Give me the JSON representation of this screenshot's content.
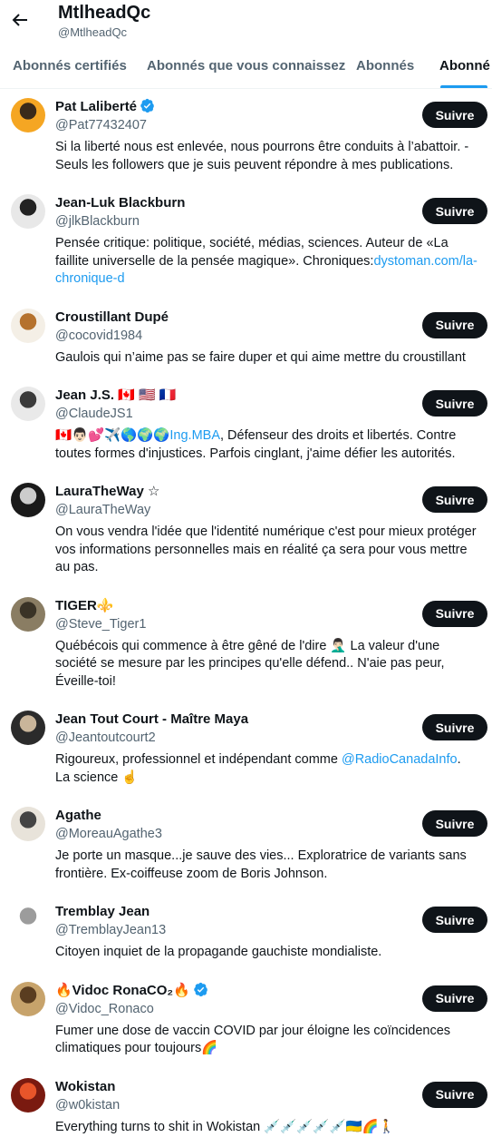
{
  "header": {
    "title": "MtlheadQc",
    "handle": "@MtlheadQc"
  },
  "tabs": [
    {
      "label": "Abonnés certifiés"
    },
    {
      "label": "Abonnés que vous connaissez"
    },
    {
      "label": "Abonnés"
    },
    {
      "label": "Abonné"
    }
  ],
  "follow_label": "Suivre",
  "accounts": [
    {
      "name": "Pat Laliberté",
      "verified": true,
      "handle": "@Pat77432407",
      "bio": "Si la liberté nous est enlevée, nous pourrons être conduits à l’abattoir. - Seuls les followers que je suis peuvent répondre à mes publications.",
      "avatar_colors": [
        "#f5a623",
        "#3a2a1a"
      ]
    },
    {
      "name": "Jean-Luk Blackburn",
      "verified": false,
      "handle": "@jlkBlackburn",
      "bio": "Pensée critique: politique, société, médias, sciences. Auteur de «La faillite universelle de la pensée magique». Chroniques:",
      "bio_link": "dystoman.com/la-chronique-d",
      "avatar_colors": [
        "#e8e8e8",
        "#222222"
      ]
    },
    {
      "name": "Croustillant Dupé",
      "verified": false,
      "handle": "@cocovid1984",
      "bio": "Gaulois qui n’aime pas se faire duper et qui aime mettre du croustillant",
      "avatar_colors": [
        "#f4efe6",
        "#b5722e"
      ]
    },
    {
      "name": "Jean J.S. 🇨🇦 🇺🇸 🇫🇷",
      "verified": false,
      "handle": "@ClaudeJS1",
      "bio_prefix": "🇨🇦👨🏻💕✈️🌎🌍",
      "bio_link": "🌍Ing.MBA",
      "bio": ", Défenseur des droits et libertés. Contre toutes formes d'injustices. Parfois cinglant, j'aime défier les autorités.",
      "avatar_colors": [
        "#e9e9e9",
        "#3b3b3b"
      ]
    },
    {
      "name": "LauraTheWay ☆",
      "verified": false,
      "handle": "@LauraTheWay",
      "bio": "On vous vendra l'idée que l'identité numérique c'est pour mieux protéger vos informations personnelles mais en réalité ça sera pour vous mettre au pas.",
      "avatar_colors": [
        "#1a1a1a",
        "#cccccc"
      ]
    },
    {
      "name": "TIGER⚜️",
      "verified": false,
      "handle": "@Steve_Tiger1",
      "bio": "Québécois qui commence à être gêné de l'dire 🤦🏻‍♂️ La valeur d'une société se mesure par les principes qu'elle défend.. N'aie pas peur, Éveille-toi!",
      "avatar_colors": [
        "#8a7d63",
        "#3a3326"
      ]
    },
    {
      "name": "Jean Tout Court - Maître Maya",
      "verified": false,
      "handle": "@Jeantoutcourt2",
      "bio": "Rigoureux, professionnel et indépendant comme ",
      "bio_link": "@RadioCanadaInfo",
      "bio_suffix": ". La science ☝️",
      "avatar_colors": [
        "#2b2b2b",
        "#c9b59a"
      ]
    },
    {
      "name": "Agathe",
      "verified": false,
      "handle": "@MoreauAgathe3",
      "bio": "Je porte un masque...je sauve des vies... Exploratrice de variants sans frontière. Ex-coiffeuse zoom de Boris Johnson.",
      "avatar_colors": [
        "#e8e3da",
        "#444444"
      ]
    },
    {
      "name": "Tremblay Jean",
      "verified": false,
      "handle": "@TremblayJean13",
      "bio": "Citoyen inquiet de la propagande gauchiste mondialiste.",
      "avatar_colors": [
        "#ffffff",
        "#9c9c9c"
      ]
    },
    {
      "name": "🔥Vidoc RonaCO₂🔥",
      "verified": true,
      "handle": "@Vidoc_Ronaco",
      "bio": "Fumer une dose de vaccin COVID par jour éloigne les coïncidences climatiques pour toujours🌈",
      "avatar_colors": [
        "#c7a36b",
        "#5a3d20"
      ]
    },
    {
      "name": "Wokistan",
      "verified": false,
      "handle": "@w0kistan",
      "bio": "Everything turns to shit in Wokistan 💉💉💉💉💉🇺🇦🌈🚶",
      "avatar_colors": [
        "#7a1a10",
        "#e8552a"
      ]
    }
  ]
}
